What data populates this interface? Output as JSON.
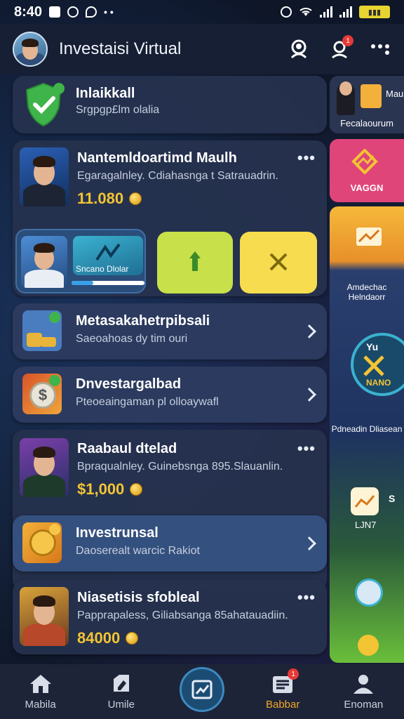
{
  "status_bar": {
    "time": "8:40"
  },
  "app_bar": {
    "title": "Investaisi Virtual",
    "notification_count": "1"
  },
  "cards": {
    "security": {
      "title": "Inlaikkall",
      "subtitle": "Srgpgp£lm olalia"
    },
    "item1": {
      "title": "Nantemldoartimd Maulh",
      "subtitle": "Egaragalnley. Cdiahasnga t Satrauadrin.",
      "price": "11.080"
    },
    "promo": {
      "label": "Sncano Dlolar"
    },
    "item2": {
      "title": "Metasakahetrpibsali",
      "subtitle": "Saeoahoas dy tim ouri"
    },
    "item3": {
      "title": "Dnvestargalbad",
      "subtitle": "Pteoeaingaman pl olloaywafl"
    },
    "item4": {
      "title": "Raabaul dtelad",
      "subtitle": "Bpraqualnley. Guinebsnga 895.Slauanlin.",
      "price": "$1,000"
    },
    "item5": {
      "title": "Investrunsal",
      "subtitle": "Daoserealt warcic Rakiot"
    },
    "item6": {
      "title": "Niasetisis sfobleal",
      "subtitle": "Papprapaless, Giliabsanga 85ahatauadiin.",
      "price": "84000"
    }
  },
  "side": {
    "tile1_label": "Fecalaourum",
    "tile1_top": "Mau",
    "tile2_label": "VAGGN",
    "tile3_top": "Amdechac Helndaorr",
    "tile3_mid": "Yu",
    "tile3_mid2": "NANO",
    "tile3_bottom": "Pdneadin Dliasean",
    "tile3_badge": "LJN7",
    "tile3_badge2": "S"
  },
  "bottom_nav": {
    "items": [
      {
        "label": "Mabila",
        "icon": "home-icon"
      },
      {
        "label": "Umile",
        "icon": "edit-icon"
      },
      {
        "label": "",
        "icon": "chart-icon"
      },
      {
        "label": "Babbar",
        "icon": "inbox-icon",
        "badge": "1"
      },
      {
        "label": "Enoman",
        "icon": "profile-icon"
      }
    ]
  },
  "colors": {
    "accent_gold": "#f3c433",
    "nav_active": "#f2a72a",
    "badge_red": "#e53935",
    "shield_green": "#3fb44a",
    "tile_green": "#c8e04a",
    "tile_yellow": "#f6dc4e",
    "tile_pink": "#e0457a"
  }
}
